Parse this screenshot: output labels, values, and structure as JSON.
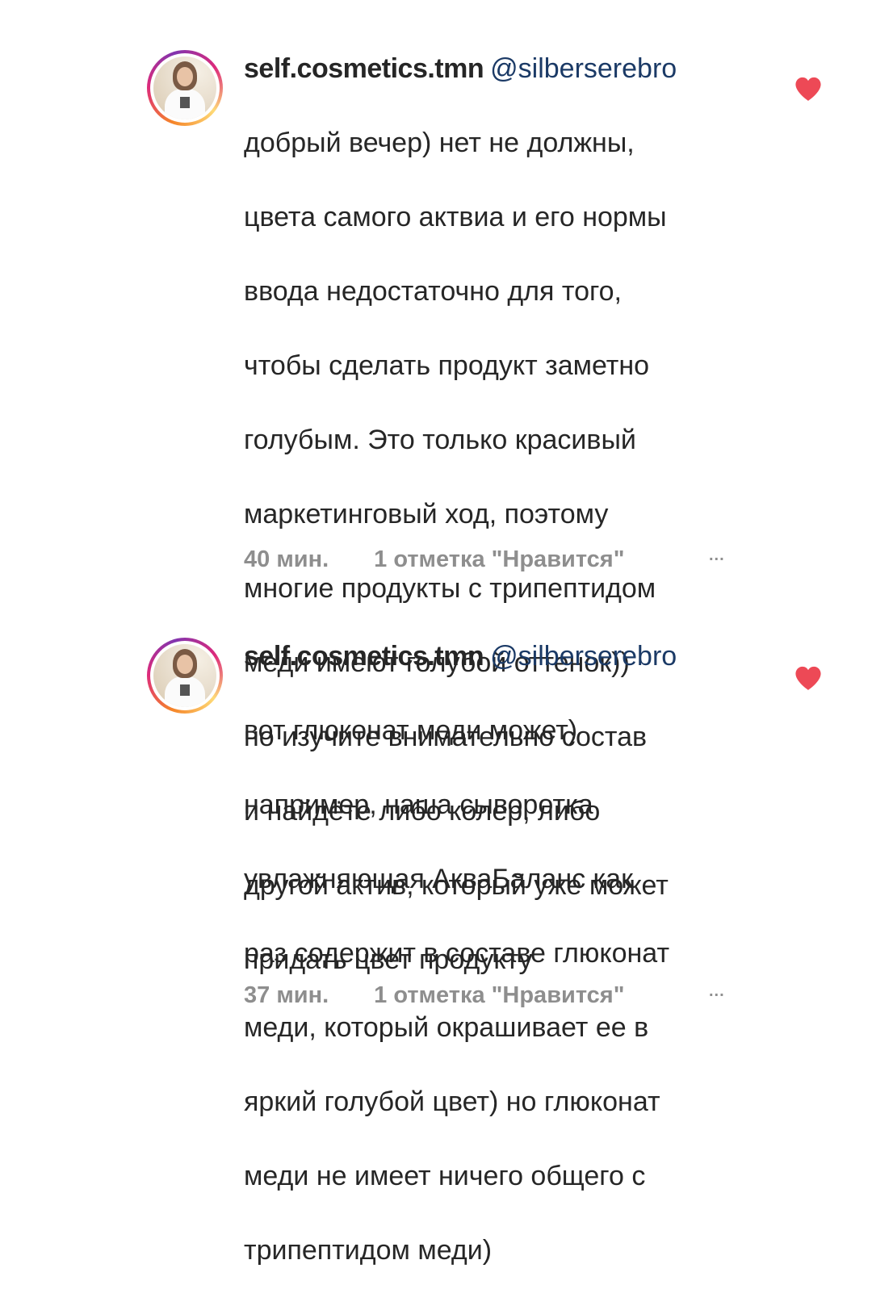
{
  "comments": [
    {
      "username": "self.cosmetics.tmn",
      "mention": "@silberserebro",
      "lines": [
        "добрый вечер) нет не должны,",
        "цвета самого актвиа и его нормы",
        "ввода недостаточно для того,",
        "чтобы сделать продукт заметно",
        "голубым. Это только красивый",
        "маркетинговый ход, поэтому",
        "многие продукты с трипептидом",
        "меди имеют голубой оттенок))",
        "но изучите внимательно состав",
        "и найдёте либо колер, либо",
        "другой актив, который уже может",
        "придать цвет продукту"
      ],
      "time": "40 мин.",
      "likes": "1 отметка \"Нравится\"",
      "more": "...",
      "liked": true
    },
    {
      "username": "self.cosmetics.tmn",
      "mention": "@silberserebro",
      "lines": [
        "вот глюконат меди может)",
        "например, наша сыворотка",
        "увлажняющая АкваБаланс как",
        "раз содержит в составе глюконат",
        "меди, который окрашивает ее в",
        "яркий голубой цвет) но глюконат",
        "меди не имеет ничего общего с",
        "трипептидом меди)"
      ],
      "time": "37 мин.",
      "likes": "1 отметка \"Нравится\"",
      "more": "...",
      "liked": true
    }
  ],
  "colors": {
    "heart": "#ed4956",
    "mention": "#1b3a66",
    "meta": "#8e8e8e",
    "text": "#262626"
  },
  "icons": {
    "heart": "heart-filled-icon",
    "avatar": "profile-photo"
  }
}
